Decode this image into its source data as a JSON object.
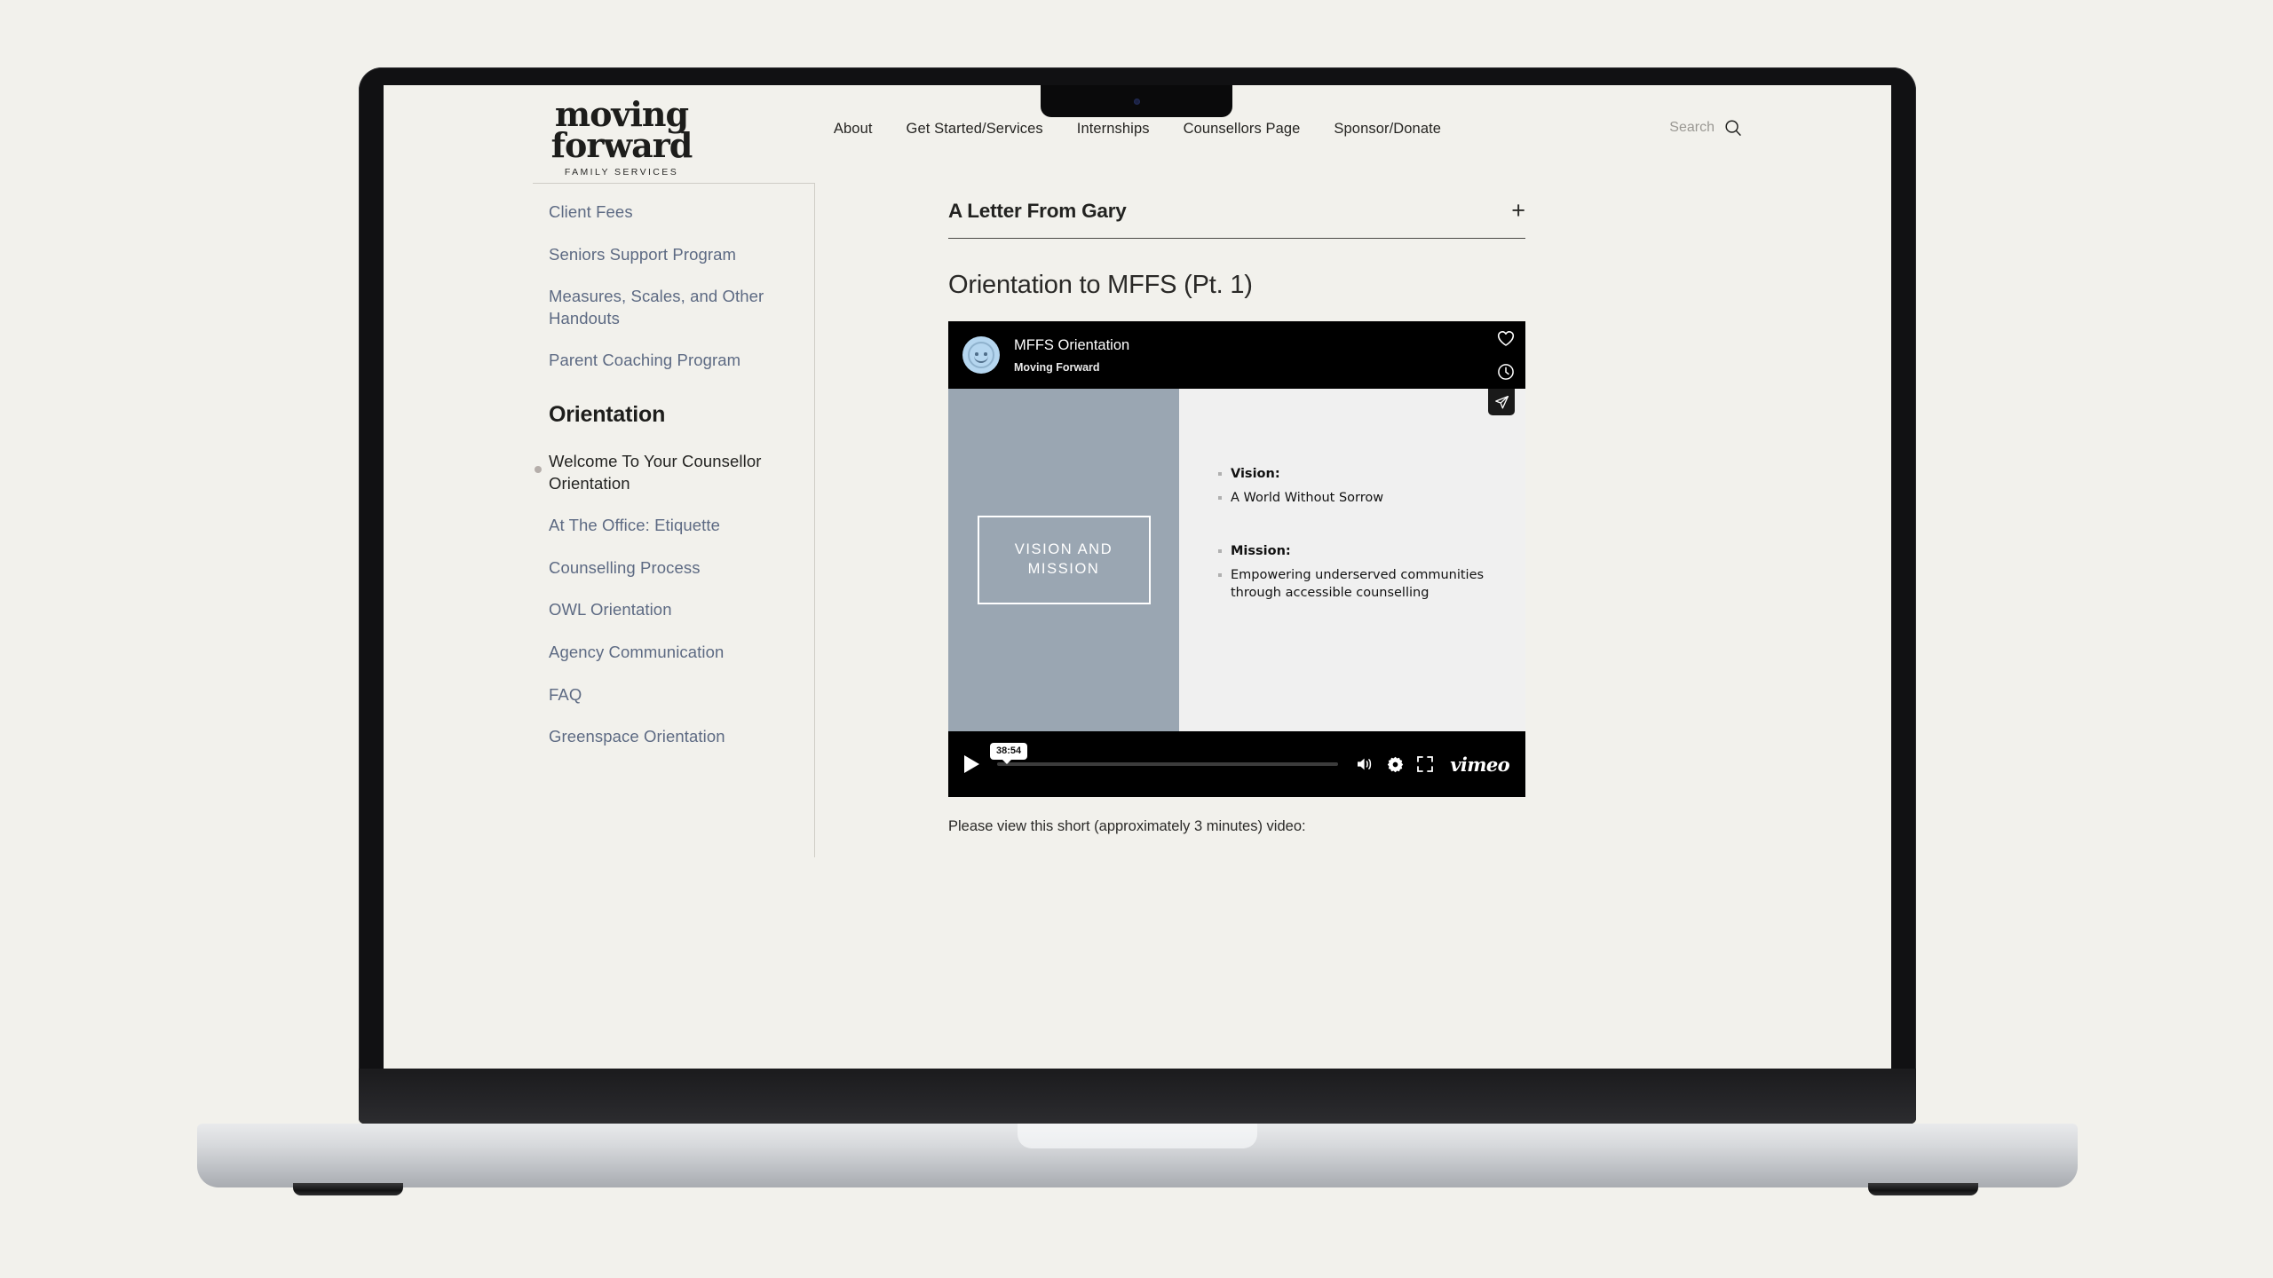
{
  "brand": {
    "logo_line1": "moving",
    "logo_line2": "forward",
    "logo_sub": "FAMILY SERVICES"
  },
  "header": {
    "nav": [
      {
        "label": "About",
        "name": "nav-about"
      },
      {
        "label": "Get Started/Services",
        "name": "nav-get-started-services"
      },
      {
        "label": "Internships",
        "name": "nav-internships"
      },
      {
        "label": "Counsellors Page",
        "name": "nav-counsellors-page"
      },
      {
        "label": "Sponsor/Donate",
        "name": "nav-sponsor-donate"
      }
    ],
    "search_label": "Search"
  },
  "sidebar": {
    "top_links": [
      {
        "label": "Client Fees"
      },
      {
        "label": "Seniors Support Program"
      },
      {
        "label": "Measures, Scales, and Other Handouts"
      },
      {
        "label": "Parent Coaching Program"
      }
    ],
    "section_heading": "Orientation",
    "orientation_links": [
      {
        "label": "Welcome To Your Counsellor Orientation",
        "active": true
      },
      {
        "label": "At The Office: Etiquette",
        "active": false
      },
      {
        "label": "Counselling Process",
        "active": false
      },
      {
        "label": "OWL Orientation",
        "active": false
      },
      {
        "label": "Agency Communication",
        "active": false
      },
      {
        "label": "FAQ",
        "active": false
      },
      {
        "label": "Greenspace Orientation",
        "active": false
      }
    ]
  },
  "main": {
    "accordion": {
      "title": "A Letter From Gary",
      "toggle_glyph": "+"
    },
    "section_title": "Orientation to MFFS (Pt. 1)",
    "caption": "Please view this short (approximately 3 minutes) video:"
  },
  "player": {
    "video_title": "MFFS Orientation",
    "owner": "Moving Forward",
    "time_tooltip": "38:54",
    "vimeo_wordmark": "vimeo",
    "actions": [
      {
        "name": "like-heart-icon"
      },
      {
        "name": "watch-later-clock-icon"
      },
      {
        "name": "share-plane-icon"
      }
    ],
    "controls": [
      {
        "name": "play-button"
      },
      {
        "name": "volume-icon"
      },
      {
        "name": "settings-gear-icon"
      },
      {
        "name": "fullscreen-icon"
      }
    ]
  },
  "slide": {
    "title_line1": "VISION AND",
    "title_line2": "MISSION",
    "bullets": [
      {
        "text": "Vision:",
        "bold": true
      },
      {
        "text": "A World Without Sorrow",
        "bold": false
      },
      {
        "text": "Mission:",
        "bold": true
      },
      {
        "text": "Empowering underserved communities through accessible counselling",
        "bold": false
      }
    ]
  },
  "colors": {
    "page_bg": "#f2f1ec",
    "sidebar_link": "#5d6a83",
    "slide_panel": "#9aa6b2",
    "avatar": "#b5d6ef",
    "player_bg": "#000000"
  }
}
